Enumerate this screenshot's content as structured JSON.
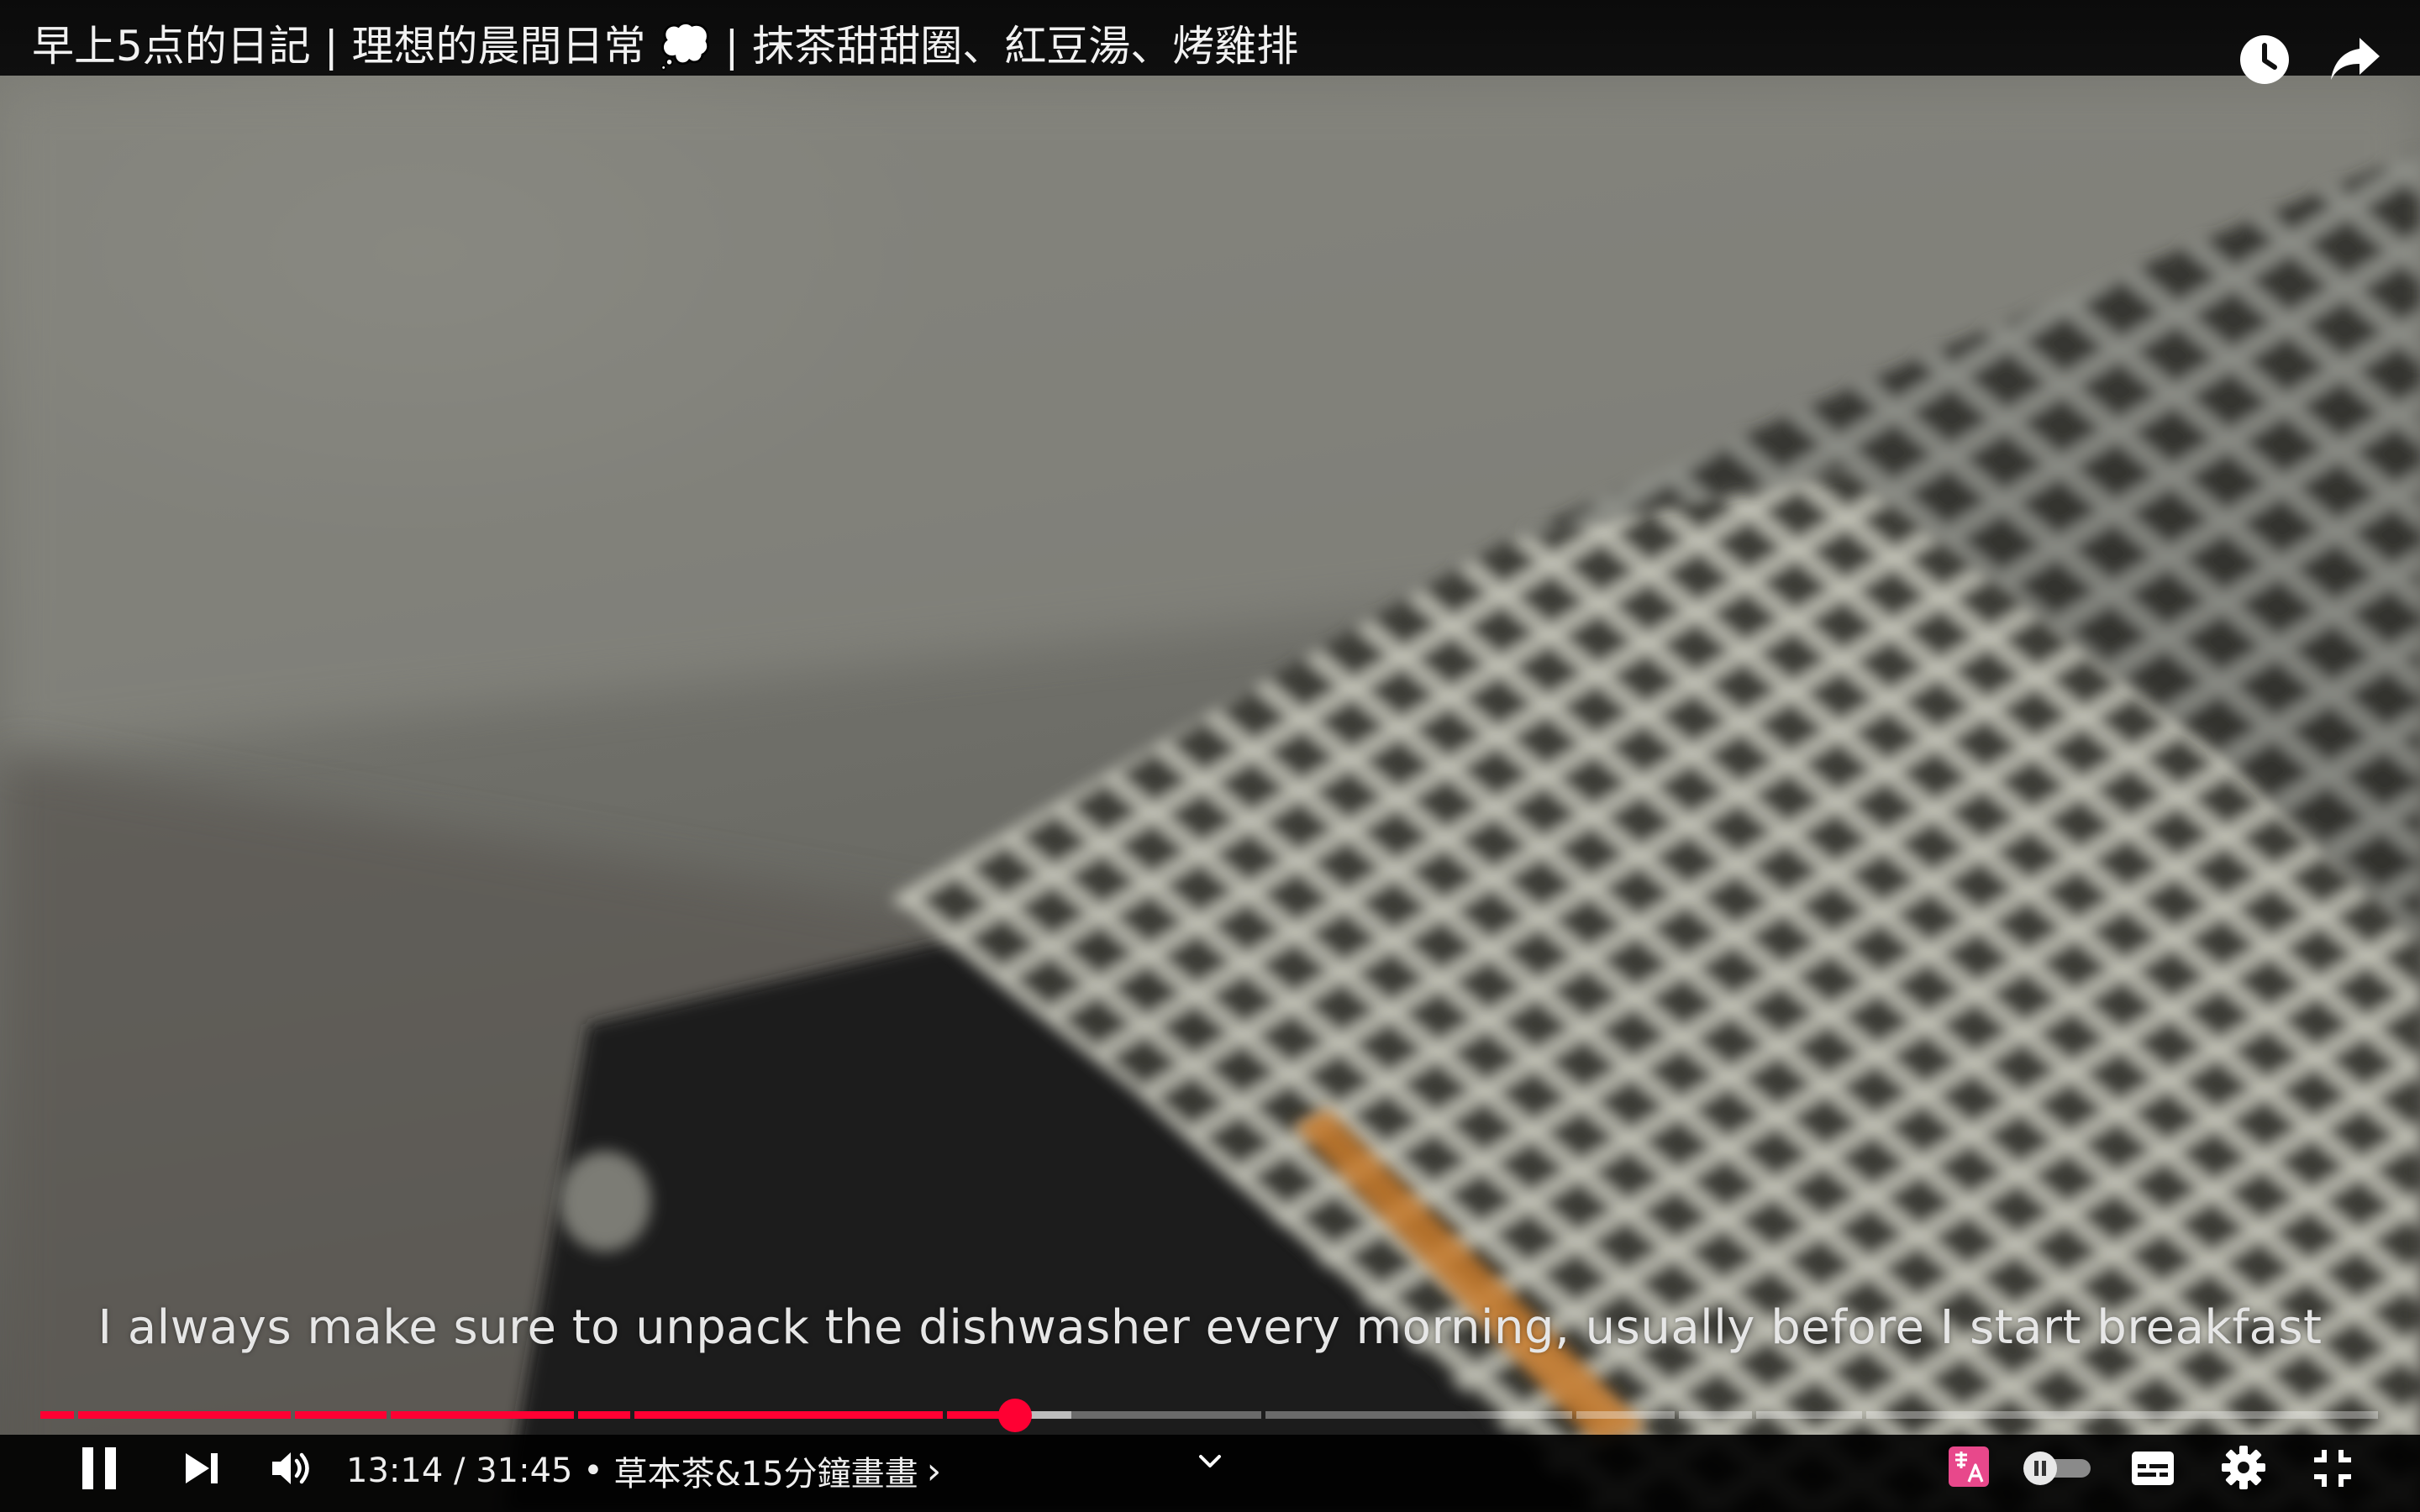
{
  "video": {
    "title": "早上5点的日記 | 理想的晨間日常 💭 | 抹茶甜甜圈、紅豆湯、烤雞排",
    "caption": "I always make sure to unpack the dishwasher every morning, usually before I start breakfast"
  },
  "player": {
    "current_time": "13:14",
    "separator": " / ",
    "duration": "31:45",
    "chapter_separator": " • ",
    "chapter": "草本茶&15分鐘畫畫",
    "chapter_chevron": "›",
    "progress_fraction": 0.417,
    "buffered_fraction": 0.441,
    "chapters": [
      0.0,
      0.016,
      0.109,
      0.15,
      0.23,
      0.254,
      0.388,
      0.524,
      0.657,
      0.701,
      0.734,
      0.781
    ],
    "icons": {
      "watch_later": "clock-icon",
      "share": "share-arrow-icon",
      "pause": "pause-icon",
      "next": "skip-next-icon",
      "volume": "volume-icon",
      "expand": "chevron-down-icon",
      "auto_translate": "translate-icon",
      "autoplay": "autoplay-toggle-icon",
      "subtitles": "subtitles-icon",
      "settings": "gear-icon",
      "exit_fullscreen": "exit-fullscreen-icon"
    },
    "colors": {
      "accent": "#ff0033",
      "translate_badge": "#e8488b"
    }
  }
}
